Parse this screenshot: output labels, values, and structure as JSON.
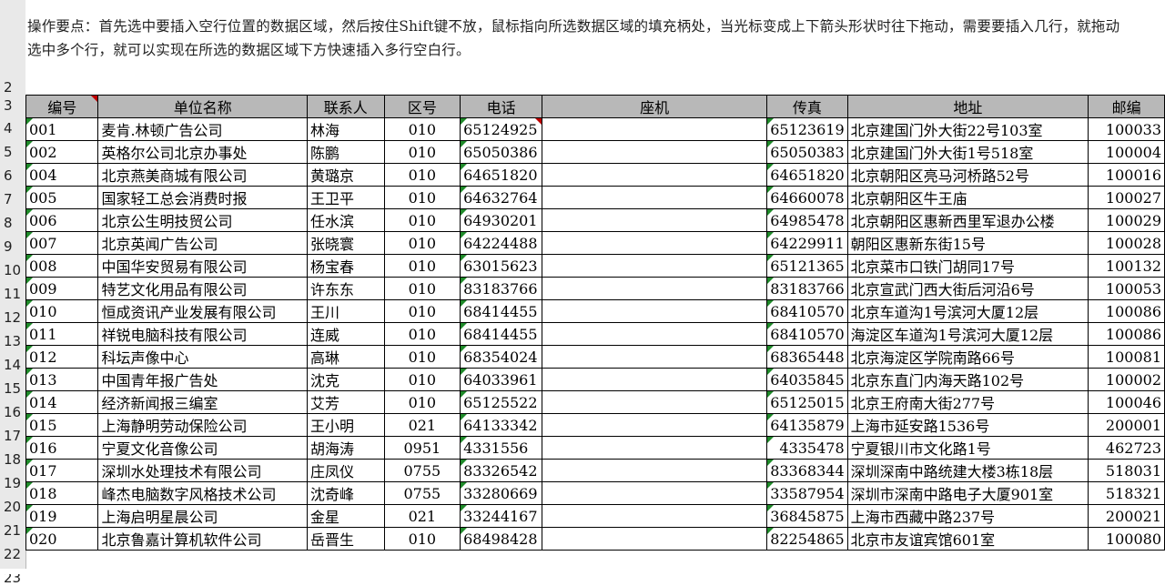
{
  "note": "操作要点：首先选中要插入空行位置的数据区域，然后按住Shift键不放，鼠标指向所选数据区域的填充柄处，当光标变成上下箭头形状时往下拖动，需要要插入几行，就拖动选中多个行，就可以实现在所选的数据区域下方快速插入多行空白行。",
  "row_numbers": [
    "2",
    "3",
    "4",
    "5",
    "6",
    "7",
    "8",
    "9",
    "10",
    "11",
    "12",
    "13",
    "14",
    "15",
    "16",
    "17",
    "18",
    "19",
    "20",
    "21",
    "22",
    "23"
  ],
  "headers": [
    "编号",
    "单位名称",
    "联系人",
    "区号",
    "电话",
    "座机",
    "传真",
    "地址",
    "邮编"
  ],
  "rows": [
    [
      "001",
      "麦肯.林顿广告公司",
      "林海",
      "010",
      "65124925",
      "",
      "65123619",
      "北京建国门外大街22号103室",
      "100033"
    ],
    [
      "002",
      "英格尔公司北京办事处",
      "陈鹏",
      "010",
      "65050386",
      "",
      "65050383",
      "北京建国门外大街1号518室",
      "100004"
    ],
    [
      "004",
      "北京燕美商城有限公司",
      "黄璐京",
      "010",
      "64651820",
      "",
      "64651820",
      "北京朝阳区亮马河桥路52号",
      "100016"
    ],
    [
      "005",
      "国家轻工总会消费时报",
      "王卫平",
      "010",
      "64632764",
      "",
      "64660078",
      "北京朝阳区牛王庙",
      "100027"
    ],
    [
      "006",
      "北京公生明技贸公司",
      "任水滨",
      "010",
      "64930201",
      "",
      "64985478",
      "北京朝阳区惠新西里军退办公楼",
      "100029"
    ],
    [
      "007",
      "北京英闻广告公司",
      "张晓寰",
      "010",
      "64224488",
      "",
      "64229911",
      "朝阳区惠新东街15号",
      "100028"
    ],
    [
      "008",
      "中国华安贸易有限公司",
      "杨宝春",
      "010",
      "63015623",
      "",
      "65121365",
      "北京菜市口铁门胡同17号",
      "100132"
    ],
    [
      "009",
      "特艺文化用品有限公司",
      "许东东",
      "010",
      "83183766",
      "",
      "83183766",
      "北京宣武门西大街后河沿6号",
      "100053"
    ],
    [
      "010",
      "恒成资讯产业发展有限公司",
      "王川",
      "010",
      "68414455",
      "",
      "68410570",
      "北京车道沟1号滨河大厦12层",
      "100086"
    ],
    [
      "011",
      "祥锐电脑科技有限公司",
      "连威",
      "010",
      "68414455",
      "",
      "68410570",
      "海淀区车道沟1号滨河大厦12层",
      "100086"
    ],
    [
      "012",
      "科坛声像中心",
      "高琳",
      "010",
      "68354024",
      "",
      "68365448",
      "北京海淀区学院南路66号",
      "100081"
    ],
    [
      "013",
      "中国青年报广告处",
      "沈克",
      "010",
      "64033961",
      "",
      "64035845",
      "北京东直门内海天路102号",
      "100002"
    ],
    [
      "014",
      "经济新闻报三编室",
      "艾芳",
      "010",
      "65125522",
      "",
      "65125015",
      "北京王府南大街277号",
      "100046"
    ],
    [
      "015",
      "上海静明劳动保险公司",
      "王小明",
      "021",
      "64133342",
      "",
      "64135879",
      "上海市延安路1536号",
      "200001"
    ],
    [
      "016",
      "宁夏文化音像公司",
      "胡海涛",
      "0951",
      "4331556",
      "",
      "4335478",
      "宁夏银川市文化路1号",
      "462723"
    ],
    [
      "017",
      "深圳水处理技术有限公司",
      "庄凤仪",
      "0755",
      "83326542",
      "",
      "83368344",
      "深圳深南中路统建大楼3栋18层",
      "518031"
    ],
    [
      "018",
      "峰杰电脑数字风格技术公司",
      "沈奇峰",
      "0755",
      "33280669",
      "",
      "33587954",
      "深圳市深南中路电子大厦901室",
      "518321"
    ],
    [
      "019",
      "上海启明星晨公司",
      "金星",
      "021",
      "33244167",
      "",
      "36845875",
      "上海市西藏中路237号",
      "200021"
    ],
    [
      "020",
      "北京鲁嘉计算机软件公司",
      "岳晋生",
      "010",
      "68498428",
      "",
      "82254865",
      "北京市友谊宾馆601室",
      "100080"
    ]
  ]
}
